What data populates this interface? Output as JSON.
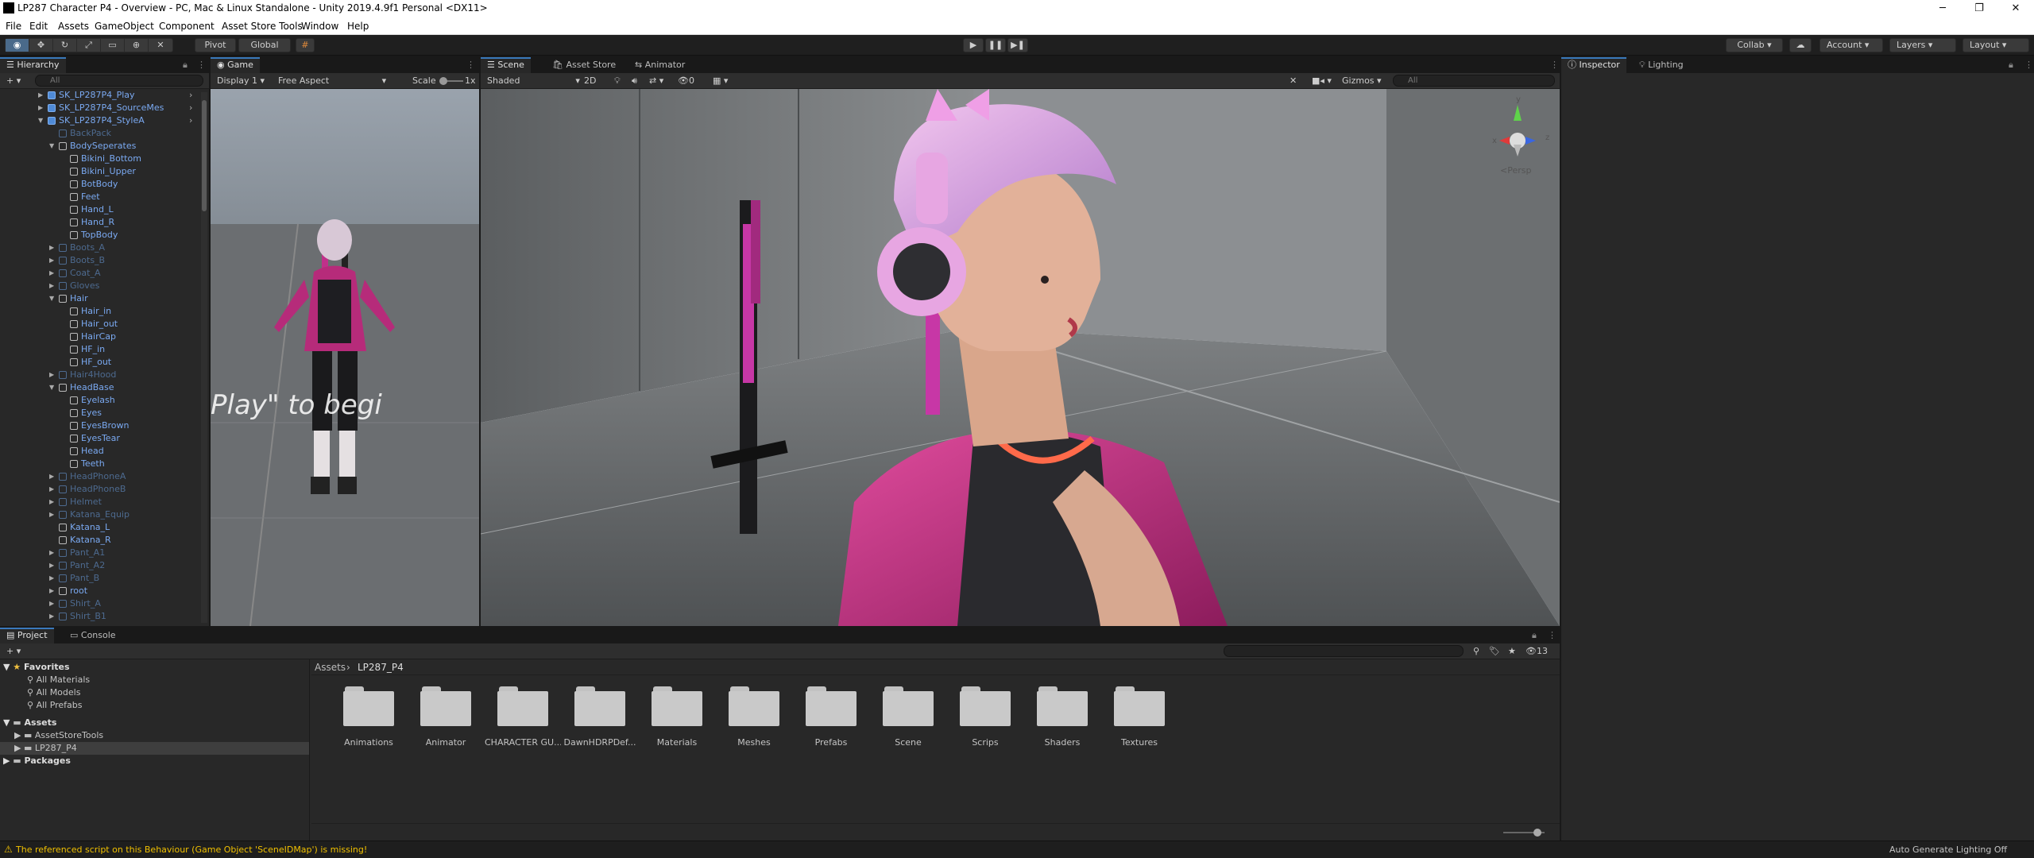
{
  "window": {
    "title": "LP287 Character P4 - Overview - PC, Mac & Linux Standalone - Unity 2019.4.9f1 Personal <DX11>",
    "minimize": "─",
    "maximize": "❐",
    "close": "✕"
  },
  "menu": [
    "File",
    "Edit",
    "Assets",
    "GameObject",
    "Component",
    "Asset Store Tools",
    "Window",
    "Help"
  ],
  "toolbar": {
    "pivot": "Pivot",
    "global": "Global",
    "collab": "Collab ▾",
    "account": "Account",
    "layers": "Layers",
    "layout": "Layout",
    "play": "▶",
    "pause": "❚❚",
    "step": "▶❚"
  },
  "hierarchy": {
    "tab": "Hierarchy",
    "search_placeholder": "All",
    "items": [
      {
        "label": "SK_LP287P4_Play",
        "indent": 0,
        "arrow": "▶",
        "kind": "prefab"
      },
      {
        "label": "SK_LP287P4_SourceMes",
        "indent": 0,
        "arrow": "▶",
        "kind": "prefab"
      },
      {
        "label": "SK_LP287P4_StyleA",
        "indent": 0,
        "arrow": "▼",
        "kind": "prefab"
      },
      {
        "label": "BackPack",
        "indent": 1,
        "arrow": "",
        "kind": "dim"
      },
      {
        "label": "BodySeperates",
        "indent": 1,
        "arrow": "▼",
        "kind": "child"
      },
      {
        "label": "Bikini_Bottom",
        "indent": 2,
        "arrow": "",
        "kind": "child"
      },
      {
        "label": "Bikini_Upper",
        "indent": 2,
        "arrow": "",
        "kind": "child"
      },
      {
        "label": "BotBody",
        "indent": 2,
        "arrow": "",
        "kind": "child"
      },
      {
        "label": "Feet",
        "indent": 2,
        "arrow": "",
        "kind": "child"
      },
      {
        "label": "Hand_L",
        "indent": 2,
        "arrow": "",
        "kind": "child"
      },
      {
        "label": "Hand_R",
        "indent": 2,
        "arrow": "",
        "kind": "child"
      },
      {
        "label": "TopBody",
        "indent": 2,
        "arrow": "",
        "kind": "child"
      },
      {
        "label": "Boots_A",
        "indent": 1,
        "arrow": "▶",
        "kind": "dim"
      },
      {
        "label": "Boots_B",
        "indent": 1,
        "arrow": "▶",
        "kind": "dim"
      },
      {
        "label": "Coat_A",
        "indent": 1,
        "arrow": "▶",
        "kind": "dim"
      },
      {
        "label": "Gloves",
        "indent": 1,
        "arrow": "▶",
        "kind": "dim"
      },
      {
        "label": "Hair",
        "indent": 1,
        "arrow": "▼",
        "kind": "child"
      },
      {
        "label": "Hair_in",
        "indent": 2,
        "arrow": "",
        "kind": "child"
      },
      {
        "label": "Hair_out",
        "indent": 2,
        "arrow": "",
        "kind": "child"
      },
      {
        "label": "HairCap",
        "indent": 2,
        "arrow": "",
        "kind": "child"
      },
      {
        "label": "HF_in",
        "indent": 2,
        "arrow": "",
        "kind": "child"
      },
      {
        "label": "HF_out",
        "indent": 2,
        "arrow": "",
        "kind": "child"
      },
      {
        "label": "Hair4Hood",
        "indent": 1,
        "arrow": "▶",
        "kind": "dim"
      },
      {
        "label": "HeadBase",
        "indent": 1,
        "arrow": "▼",
        "kind": "child"
      },
      {
        "label": "Eyelash",
        "indent": 2,
        "arrow": "",
        "kind": "child"
      },
      {
        "label": "Eyes",
        "indent": 2,
        "arrow": "",
        "kind": "child"
      },
      {
        "label": "EyesBrown",
        "indent": 2,
        "arrow": "",
        "kind": "child"
      },
      {
        "label": "EyesTear",
        "indent": 2,
        "arrow": "",
        "kind": "child"
      },
      {
        "label": "Head",
        "indent": 2,
        "arrow": "",
        "kind": "child"
      },
      {
        "label": "Teeth",
        "indent": 2,
        "arrow": "",
        "kind": "child"
      },
      {
        "label": "HeadPhoneA",
        "indent": 1,
        "arrow": "▶",
        "kind": "dim"
      },
      {
        "label": "HeadPhoneB",
        "indent": 1,
        "arrow": "▶",
        "kind": "dim"
      },
      {
        "label": "Helmet",
        "indent": 1,
        "arrow": "▶",
        "kind": "dim"
      },
      {
        "label": "Katana_Equip",
        "indent": 1,
        "arrow": "▶",
        "kind": "dim"
      },
      {
        "label": "Katana_L",
        "indent": 1,
        "arrow": "",
        "kind": "child"
      },
      {
        "label": "Katana_R",
        "indent": 1,
        "arrow": "",
        "kind": "child"
      },
      {
        "label": "Pant_A1",
        "indent": 1,
        "arrow": "▶",
        "kind": "dim"
      },
      {
        "label": "Pant_A2",
        "indent": 1,
        "arrow": "▶",
        "kind": "dim"
      },
      {
        "label": "Pant_B",
        "indent": 1,
        "arrow": "▶",
        "kind": "dim"
      },
      {
        "label": "root",
        "indent": 1,
        "arrow": "▶",
        "kind": "child"
      },
      {
        "label": "Shirt_A",
        "indent": 1,
        "arrow": "▶",
        "kind": "dim"
      },
      {
        "label": "Shirt_B1",
        "indent": 1,
        "arrow": "▶",
        "kind": "dim"
      }
    ]
  },
  "game": {
    "tab": "Game",
    "display": "Display 1",
    "aspect": "Free Aspect",
    "scale_label": "Scale",
    "scale_value": "1x",
    "overlay_text": "Play\" to begi"
  },
  "scene": {
    "tabs": [
      "Scene",
      "Asset Store",
      "Animator"
    ],
    "shading": "Shaded",
    "mode_2d": "2D",
    "hidden_count": "0",
    "gizmos": "Gizmos",
    "search_placeholder": "All",
    "persp": "<Persp",
    "axis_y": "y",
    "axis_x": "x",
    "axis_z": "z"
  },
  "inspector": {
    "tabs": [
      "Inspector",
      "Lighting"
    ]
  },
  "project": {
    "tabs": [
      "Project",
      "Console"
    ],
    "favorites_label": "Favorites",
    "favorites": [
      "All Materials",
      "All Models",
      "All Prefabs"
    ],
    "assets_label": "Assets",
    "asset_children": [
      "AssetStoreTools",
      "LP287_P4"
    ],
    "packages_label": "Packages",
    "breadcrumb": [
      "Assets",
      "LP287_P4"
    ],
    "hidden_count": "13",
    "folders": [
      "Animations",
      "Animator",
      "CHARACTER GU...",
      "DawnHDRPDef...",
      "Materials",
      "Meshes",
      "Prefabs",
      "Scene",
      "Scrips",
      "Shaders",
      "Textures"
    ]
  },
  "status": {
    "warning": "The referenced script on this Behaviour (Game Object 'SceneIDMap') is missing!",
    "right": "Auto Generate Lighting Off"
  }
}
